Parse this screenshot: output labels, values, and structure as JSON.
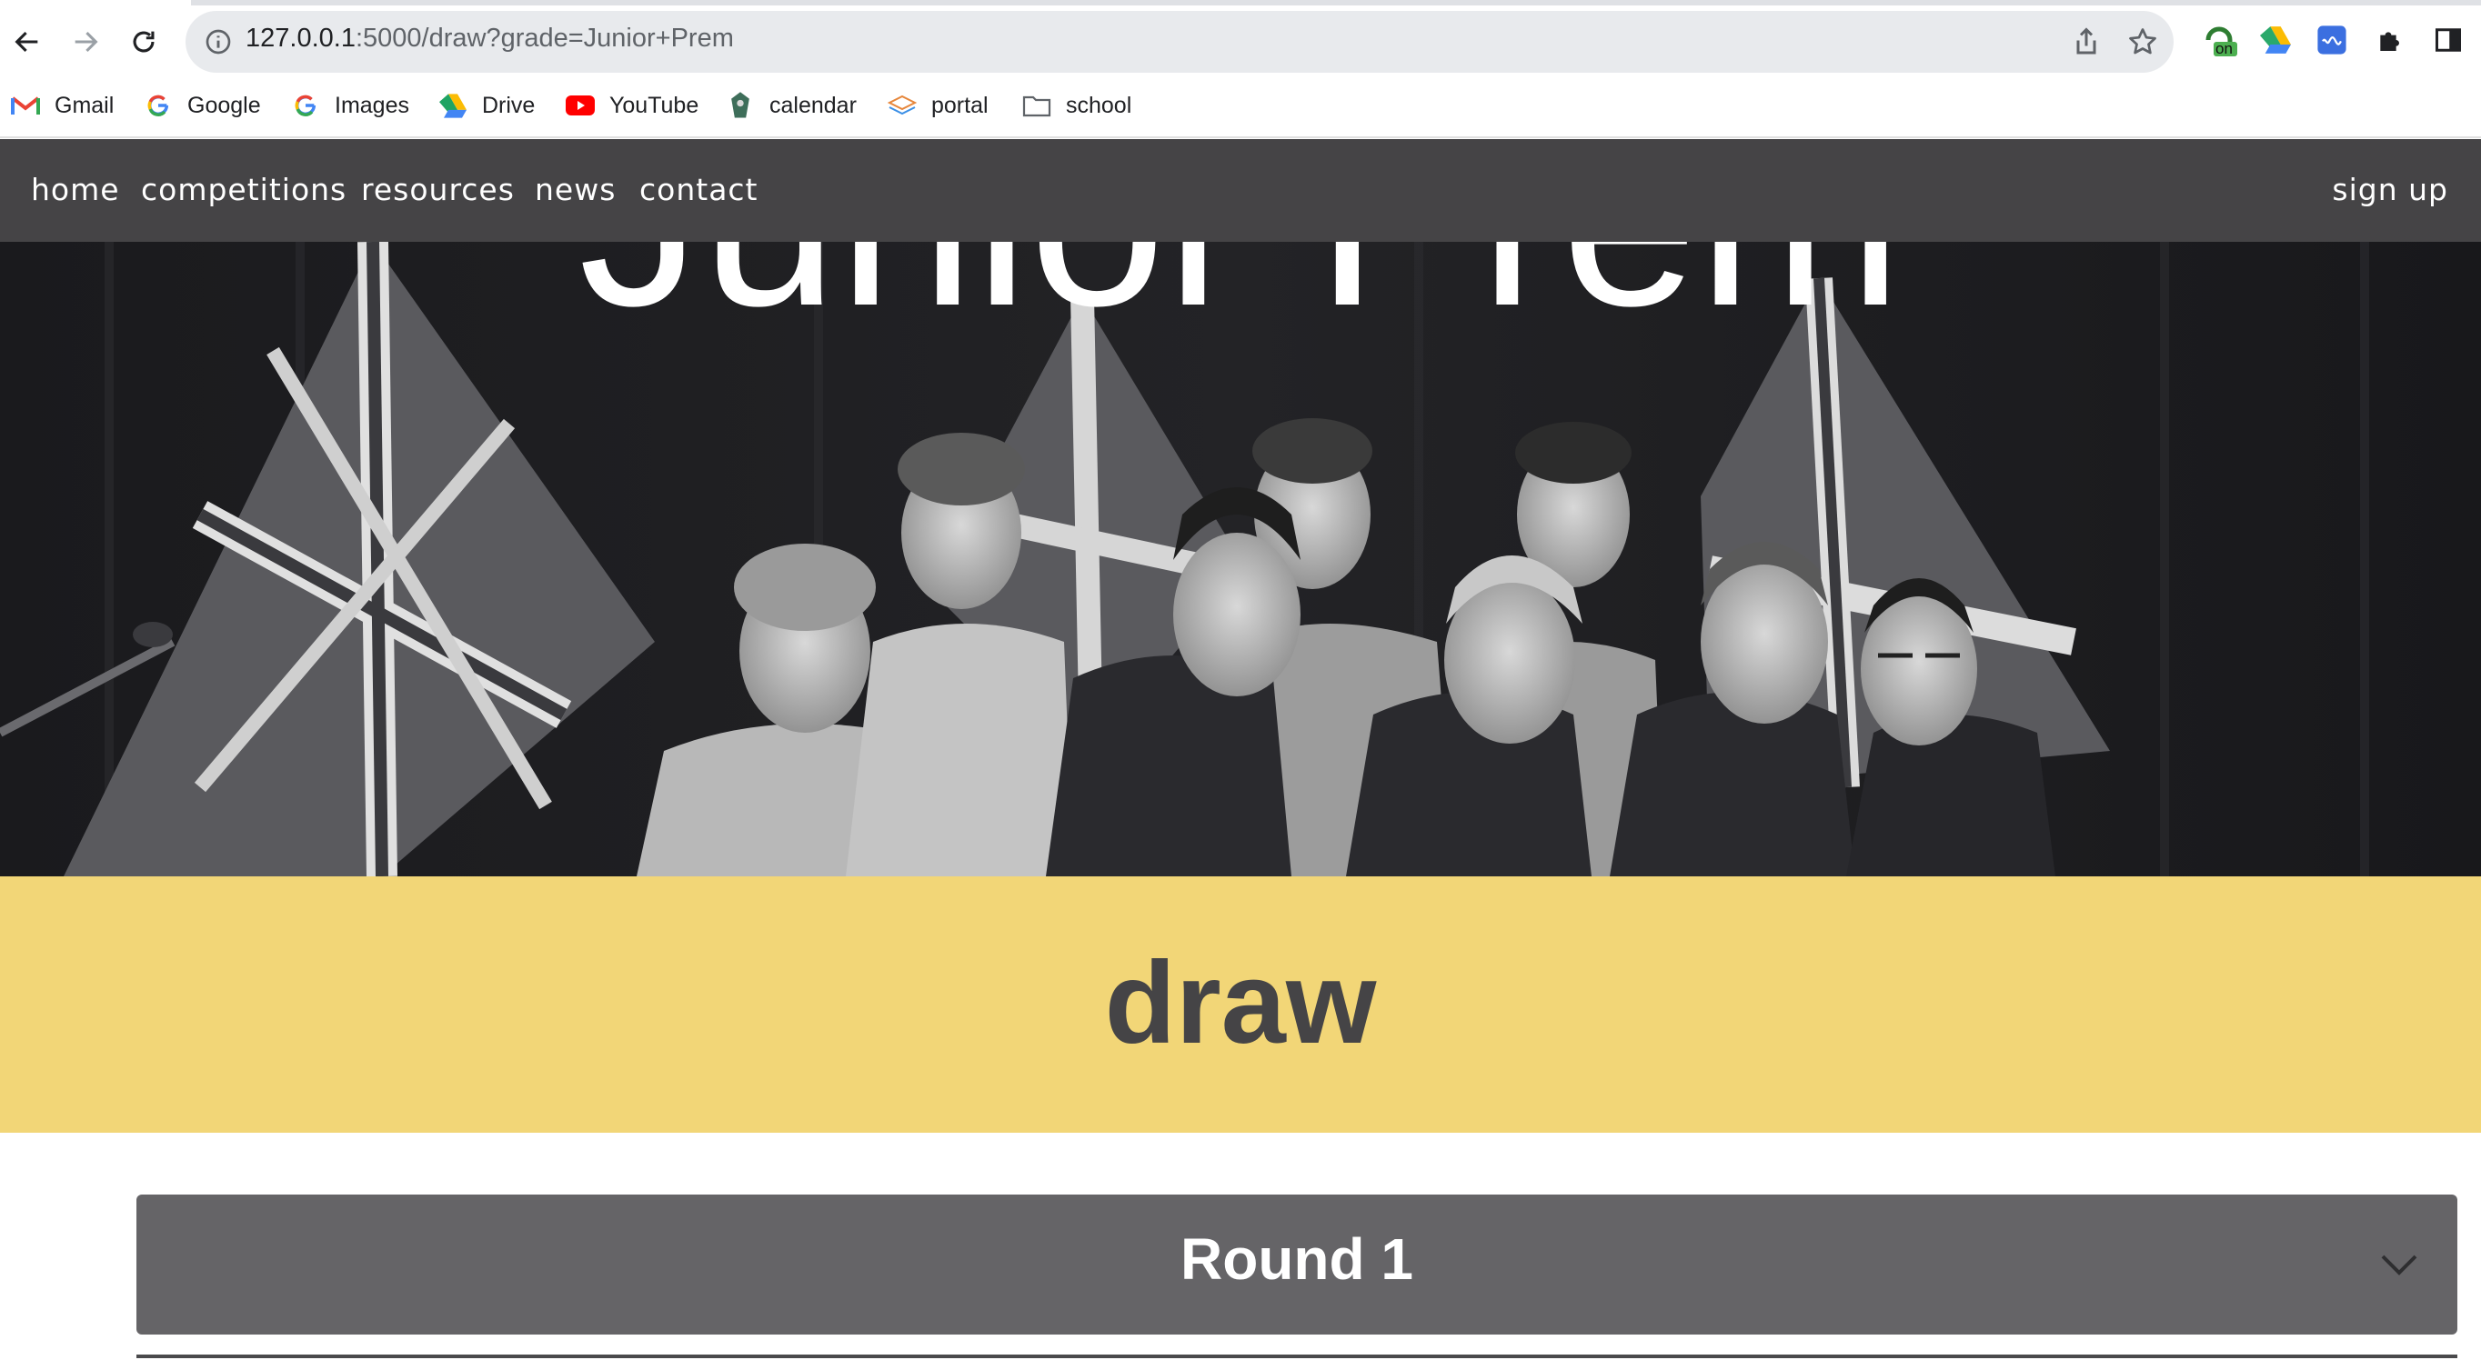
{
  "browser": {
    "url_host": "127.0.0.1",
    "url_rest": ":5000/draw?grade=Junior+Prem",
    "bookmarks": [
      {
        "label": "Gmail",
        "icon": "gmail-icon"
      },
      {
        "label": "Google",
        "icon": "google-icon"
      },
      {
        "label": "Images",
        "icon": "google-icon"
      },
      {
        "label": "Drive",
        "icon": "drive-icon"
      },
      {
        "label": "YouTube",
        "icon": "youtube-icon"
      },
      {
        "label": "calendar",
        "icon": "crest-icon"
      },
      {
        "label": "portal",
        "icon": "layers-icon"
      },
      {
        "label": "school",
        "icon": "folder-icon"
      }
    ],
    "extension_badge": "on"
  },
  "navbar": {
    "links": [
      "home",
      "competitions",
      "resources",
      "news",
      "contact"
    ],
    "signup": "sign up"
  },
  "hero": {
    "title": "Junior Prem"
  },
  "banner": {
    "title": "draw"
  },
  "rounds": [
    {
      "title": "Round 1"
    }
  ],
  "colors": {
    "navbar": "#454446",
    "banner": "#f2d677",
    "round_card": "#656467"
  }
}
